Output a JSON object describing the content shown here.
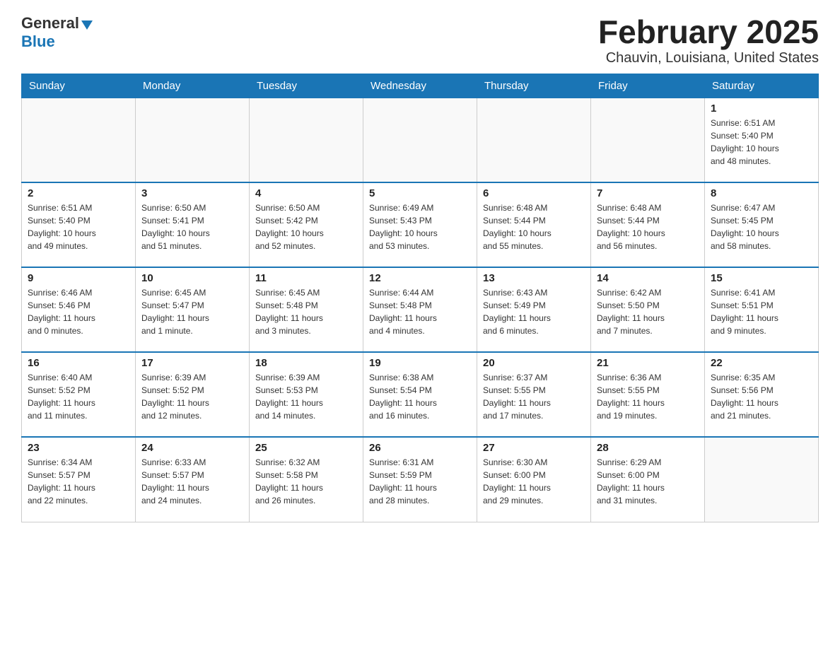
{
  "header": {
    "logo_line1_dark": "General",
    "logo_triangle": "▶",
    "logo_line2": "Blue",
    "title": "February 2025",
    "subtitle": "Chauvin, Louisiana, United States"
  },
  "days_of_week": [
    "Sunday",
    "Monday",
    "Tuesday",
    "Wednesday",
    "Thursday",
    "Friday",
    "Saturday"
  ],
  "weeks": [
    {
      "days": [
        {
          "num": "",
          "info": ""
        },
        {
          "num": "",
          "info": ""
        },
        {
          "num": "",
          "info": ""
        },
        {
          "num": "",
          "info": ""
        },
        {
          "num": "",
          "info": ""
        },
        {
          "num": "",
          "info": ""
        },
        {
          "num": "1",
          "info": "Sunrise: 6:51 AM\nSunset: 5:40 PM\nDaylight: 10 hours\nand 48 minutes."
        }
      ]
    },
    {
      "days": [
        {
          "num": "2",
          "info": "Sunrise: 6:51 AM\nSunset: 5:40 PM\nDaylight: 10 hours\nand 49 minutes."
        },
        {
          "num": "3",
          "info": "Sunrise: 6:50 AM\nSunset: 5:41 PM\nDaylight: 10 hours\nand 51 minutes."
        },
        {
          "num": "4",
          "info": "Sunrise: 6:50 AM\nSunset: 5:42 PM\nDaylight: 10 hours\nand 52 minutes."
        },
        {
          "num": "5",
          "info": "Sunrise: 6:49 AM\nSunset: 5:43 PM\nDaylight: 10 hours\nand 53 minutes."
        },
        {
          "num": "6",
          "info": "Sunrise: 6:48 AM\nSunset: 5:44 PM\nDaylight: 10 hours\nand 55 minutes."
        },
        {
          "num": "7",
          "info": "Sunrise: 6:48 AM\nSunset: 5:44 PM\nDaylight: 10 hours\nand 56 minutes."
        },
        {
          "num": "8",
          "info": "Sunrise: 6:47 AM\nSunset: 5:45 PM\nDaylight: 10 hours\nand 58 minutes."
        }
      ]
    },
    {
      "days": [
        {
          "num": "9",
          "info": "Sunrise: 6:46 AM\nSunset: 5:46 PM\nDaylight: 11 hours\nand 0 minutes."
        },
        {
          "num": "10",
          "info": "Sunrise: 6:45 AM\nSunset: 5:47 PM\nDaylight: 11 hours\nand 1 minute."
        },
        {
          "num": "11",
          "info": "Sunrise: 6:45 AM\nSunset: 5:48 PM\nDaylight: 11 hours\nand 3 minutes."
        },
        {
          "num": "12",
          "info": "Sunrise: 6:44 AM\nSunset: 5:48 PM\nDaylight: 11 hours\nand 4 minutes."
        },
        {
          "num": "13",
          "info": "Sunrise: 6:43 AM\nSunset: 5:49 PM\nDaylight: 11 hours\nand 6 minutes."
        },
        {
          "num": "14",
          "info": "Sunrise: 6:42 AM\nSunset: 5:50 PM\nDaylight: 11 hours\nand 7 minutes."
        },
        {
          "num": "15",
          "info": "Sunrise: 6:41 AM\nSunset: 5:51 PM\nDaylight: 11 hours\nand 9 minutes."
        }
      ]
    },
    {
      "days": [
        {
          "num": "16",
          "info": "Sunrise: 6:40 AM\nSunset: 5:52 PM\nDaylight: 11 hours\nand 11 minutes."
        },
        {
          "num": "17",
          "info": "Sunrise: 6:39 AM\nSunset: 5:52 PM\nDaylight: 11 hours\nand 12 minutes."
        },
        {
          "num": "18",
          "info": "Sunrise: 6:39 AM\nSunset: 5:53 PM\nDaylight: 11 hours\nand 14 minutes."
        },
        {
          "num": "19",
          "info": "Sunrise: 6:38 AM\nSunset: 5:54 PM\nDaylight: 11 hours\nand 16 minutes."
        },
        {
          "num": "20",
          "info": "Sunrise: 6:37 AM\nSunset: 5:55 PM\nDaylight: 11 hours\nand 17 minutes."
        },
        {
          "num": "21",
          "info": "Sunrise: 6:36 AM\nSunset: 5:55 PM\nDaylight: 11 hours\nand 19 minutes."
        },
        {
          "num": "22",
          "info": "Sunrise: 6:35 AM\nSunset: 5:56 PM\nDaylight: 11 hours\nand 21 minutes."
        }
      ]
    },
    {
      "days": [
        {
          "num": "23",
          "info": "Sunrise: 6:34 AM\nSunset: 5:57 PM\nDaylight: 11 hours\nand 22 minutes."
        },
        {
          "num": "24",
          "info": "Sunrise: 6:33 AM\nSunset: 5:57 PM\nDaylight: 11 hours\nand 24 minutes."
        },
        {
          "num": "25",
          "info": "Sunrise: 6:32 AM\nSunset: 5:58 PM\nDaylight: 11 hours\nand 26 minutes."
        },
        {
          "num": "26",
          "info": "Sunrise: 6:31 AM\nSunset: 5:59 PM\nDaylight: 11 hours\nand 28 minutes."
        },
        {
          "num": "27",
          "info": "Sunrise: 6:30 AM\nSunset: 6:00 PM\nDaylight: 11 hours\nand 29 minutes."
        },
        {
          "num": "28",
          "info": "Sunrise: 6:29 AM\nSunset: 6:00 PM\nDaylight: 11 hours\nand 31 minutes."
        },
        {
          "num": "",
          "info": ""
        }
      ]
    }
  ]
}
